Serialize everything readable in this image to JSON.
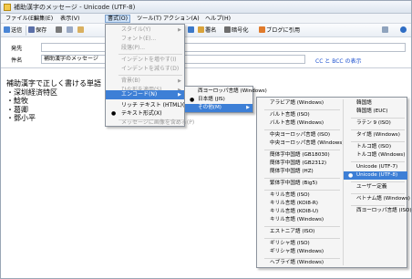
{
  "window": {
    "title": "補助漢字のメッセージ - Unicode (UTF-8)"
  },
  "menubar": [
    "ファイル(E)",
    "編集(E)",
    "表示(V)",
    "書式(O)",
    "ツール(T)",
    "アクション(A)",
    "ヘルプ(H)"
  ],
  "toolbar": {
    "send": "送信",
    "save": "保存",
    "signature": "署名",
    "encrypt": "暗号化",
    "blog": "ブログに引用"
  },
  "header": {
    "from_label": "発先",
    "subject_label": "件名",
    "subject_value": "補助漢字のメッセージ",
    "cc_link": "CC と BCC の表示"
  },
  "body": {
    "lines": [
      "補助漢字で正しく書ける単語",
      "・深圳経済特区",
      "・鯰牧",
      "・葛卿",
      "・鄧小平"
    ]
  },
  "format_menu": {
    "items": [
      {
        "label": "スタイル(Y)",
        "disabled": true
      },
      {
        "label": "フォント(E)...",
        "disabled": true
      },
      {
        "label": "段落(P)...",
        "disabled": true
      },
      {
        "label": "インデントを増やす(I)",
        "disabled": true
      },
      {
        "label": "インデントを減らす(D)",
        "disabled": true
      },
      {
        "label": "背景(B)",
        "disabled": true
      },
      {
        "label": "ひな形を適用(S)",
        "disabled": true
      },
      {
        "label": "エンコード(N)",
        "disabled": false
      },
      {
        "label": "リッチ テキスト (HTML)(H)",
        "disabled": false
      },
      {
        "label": "テキスト形式(X)",
        "disabled": false
      },
      {
        "label": "メッセージに画像を含める(P)",
        "disabled": true
      }
    ]
  },
  "encode_menu": {
    "items": [
      "西ヨーロッパ言語 (Windows)",
      "日本語 (JIS)",
      "その他(M)"
    ]
  },
  "more_menu_left": {
    "items": [
      "アラビア語 (Windows)",
      "バルト言語 (ISO)",
      "バルト言語 (Windows)",
      "中央ヨーロッパ言語 (ISO)",
      "中央ヨーロッパ言語 (Windows)",
      "簡体字中国語 (GB18030)",
      "簡体字中国語 (GB2312)",
      "簡体字中国語 (HZ)",
      "繁体字中国語 (Big5)",
      "キリル言語 (ISO)",
      "キリル言語 (KOI8-R)",
      "キリル言語 (KOI8-U)",
      "キリル言語 (Windows)",
      "エストニア語 (ISO)",
      "ギリシャ語 (ISO)",
      "ギリシャ語 (Windows)",
      "ヘブライ語 (Windows)"
    ]
  },
  "more_menu_right": {
    "items": [
      "韓国語",
      "韓国語 (EUC)",
      "ラテン 9 (ISO)",
      "タイ語 (Windows)",
      "トルコ語 (ISO)",
      "トルコ語 (Windows)",
      "Unicode (UTF-7)",
      "Unicode (UTF-8)",
      "ユーザー定義",
      "ベトナム語 (Windows)",
      "西ヨーロッパ言語 (ISO)"
    ]
  }
}
